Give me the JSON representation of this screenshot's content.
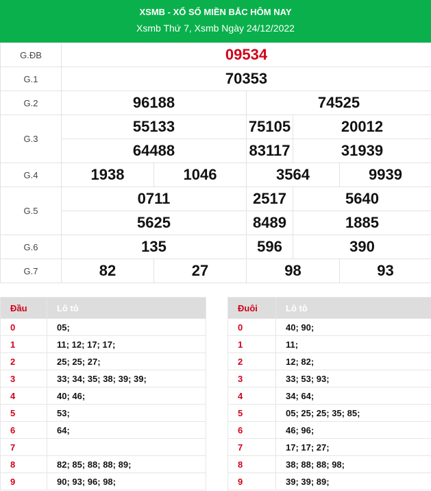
{
  "header": {
    "title": "XSMB - XỔ SỐ MIỀN BẮC HÔM NAY",
    "subtitle": "Xsmb Thứ 7, Xsmb Ngày 24/12/2022"
  },
  "results": {
    "gdb": {
      "label": "G.ĐB",
      "values": [
        "09534"
      ]
    },
    "g1": {
      "label": "G.1",
      "values": [
        "70353"
      ]
    },
    "g2": {
      "label": "G.2",
      "values": [
        "96188",
        "74525"
      ]
    },
    "g3": {
      "label": "G.3",
      "values": [
        "55133",
        "75105",
        "20012",
        "64488",
        "83117",
        "31939"
      ]
    },
    "g4": {
      "label": "G.4",
      "values": [
        "1938",
        "1046",
        "3564",
        "9939"
      ]
    },
    "g5": {
      "label": "G.5",
      "values": [
        "0711",
        "2517",
        "5640",
        "5625",
        "8489",
        "1885"
      ]
    },
    "g6": {
      "label": "G.6",
      "values": [
        "135",
        "596",
        "390"
      ]
    },
    "g7": {
      "label": "G.7",
      "values": [
        "82",
        "27",
        "98",
        "93"
      ]
    }
  },
  "loto_dau": {
    "header_key": "Đầu",
    "header_val": "Lô tô",
    "rows": [
      {
        "key": "0",
        "val": "05;"
      },
      {
        "key": "1",
        "val": "11; 12; 17; 17;"
      },
      {
        "key": "2",
        "val": "25; 25; 27;"
      },
      {
        "key": "3",
        "val": "33; 34; 35; 38; 39; 39;"
      },
      {
        "key": "4",
        "val": "40; 46;"
      },
      {
        "key": "5",
        "val": "53;"
      },
      {
        "key": "6",
        "val": "64;"
      },
      {
        "key": "7",
        "val": ""
      },
      {
        "key": "8",
        "val": "82; 85; 88; 88; 89;"
      },
      {
        "key": "9",
        "val": "90; 93; 96; 98;"
      }
    ]
  },
  "loto_duoi": {
    "header_key": "Đuôi",
    "header_val": "Lô tô",
    "rows": [
      {
        "key": "0",
        "val": "40; 90;"
      },
      {
        "key": "1",
        "val": "11;"
      },
      {
        "key": "2",
        "val": "12; 82;"
      },
      {
        "key": "3",
        "val": "33; 53; 93;"
      },
      {
        "key": "4",
        "val": "34; 64;"
      },
      {
        "key": "5",
        "val": "05; 25; 25; 35; 85;"
      },
      {
        "key": "6",
        "val": "46; 96;"
      },
      {
        "key": "7",
        "val": "17; 17; 27;"
      },
      {
        "key": "8",
        "val": "38; 88; 88; 98;"
      },
      {
        "key": "9",
        "val": "39; 39; 89;"
      }
    ]
  },
  "colors": {
    "header_bg": "#0ab04b",
    "special_prize": "#d0021b",
    "loto_key": "#d0021b"
  }
}
